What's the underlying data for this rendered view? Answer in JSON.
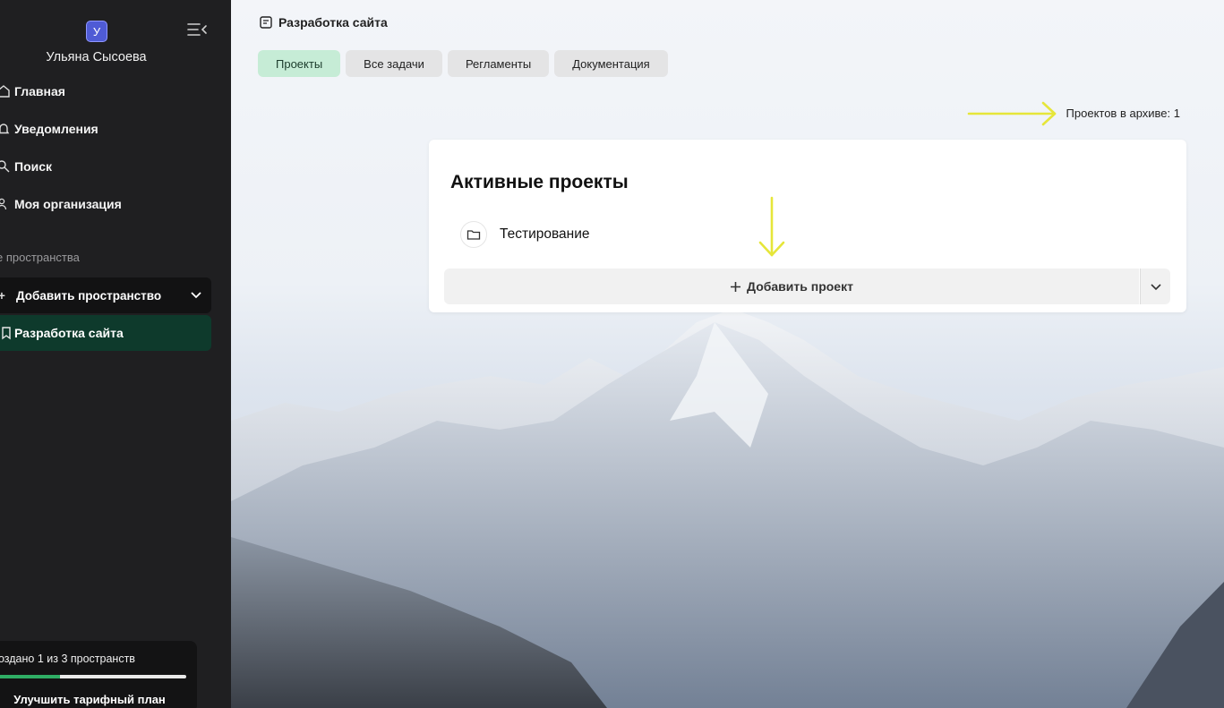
{
  "sidebar": {
    "avatar_letter": "У",
    "user_name": "Ульяна Сысоева",
    "nav": [
      {
        "label": "Главная",
        "icon": "home-icon"
      },
      {
        "label": "Уведомления",
        "icon": "bell-icon"
      },
      {
        "label": "Поиск",
        "icon": "search-icon"
      },
      {
        "label": "Моя организация",
        "icon": "people-icon"
      }
    ],
    "section_label": "е пространства",
    "add_space_label": "Добавить пространство",
    "space_item_label": "Разработка сайта",
    "plan": {
      "text": "оздано 1 из 3 пространств",
      "progress": 0.33,
      "button_label": "Улучшить тарифный план"
    }
  },
  "header": {
    "title": "Разработка сайта",
    "tabs": [
      "Проекты",
      "Все задачи",
      "Регламенты",
      "Документация"
    ],
    "active_tab": "Проекты"
  },
  "main": {
    "archive_text": "Проектов в архиве: 1",
    "card_title": "Активные проекты",
    "projects": [
      {
        "name": "Тестирование"
      }
    ],
    "add_project_label": "Добавить проект"
  },
  "colors": {
    "sidebar_bg": "#1f1f21",
    "active_tab_bg": "#c6ecd6",
    "active_space_bg": "#0e3a2c",
    "annotation_arrow": "#e6e63a",
    "progress_fill": "#2fae65"
  }
}
